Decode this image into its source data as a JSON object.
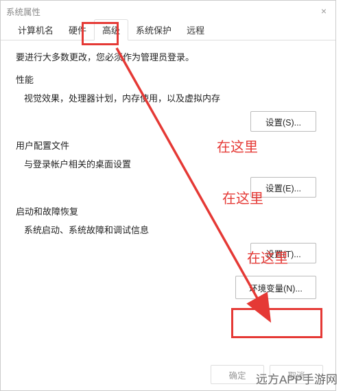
{
  "window": {
    "title": "系统属性",
    "close_icon": "×"
  },
  "tabs": {
    "computer_name": "计算机名",
    "hardware": "硬件",
    "advanced": "高级",
    "system_protection": "系统保护",
    "remote": "远程"
  },
  "intro": "要进行大多数更改，您必须作为管理员登录。",
  "sections": {
    "performance": {
      "title": "性能",
      "desc": "视觉效果，处理器计划，内存使用，以及虚拟内存",
      "button": "设置(S)..."
    },
    "user_profiles": {
      "title": "用户配置文件",
      "desc": "与登录帐户相关的桌面设置",
      "button": "设置(E)..."
    },
    "startup": {
      "title": "启动和故障恢复",
      "desc": "系统启动、系统故障和调试信息",
      "button": "设置(T)..."
    }
  },
  "env_button": "环境变量(N)...",
  "bottom": {
    "ok": "确定",
    "cancel": "取消"
  },
  "annotations": {
    "label1": "在这里",
    "label2": "在这里",
    "label3": "在这里"
  },
  "watermark": "远方APP手游网",
  "colors": {
    "highlight": "#e53935"
  }
}
